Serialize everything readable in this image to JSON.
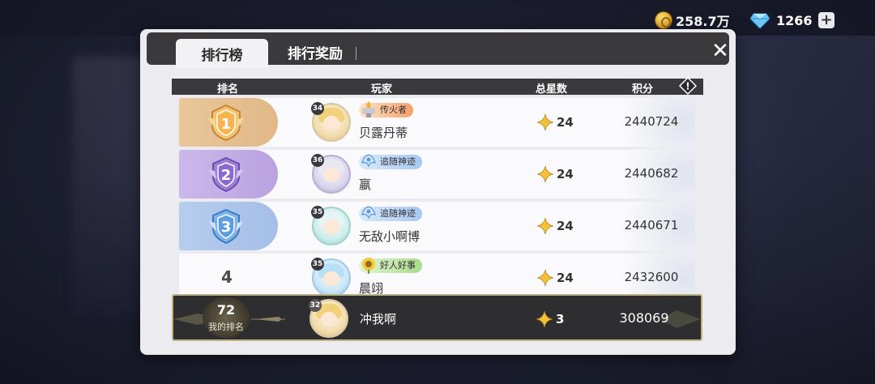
{
  "currency": {
    "coins": "258.7万",
    "gems": "1266",
    "add_label": "+"
  },
  "tabs": [
    {
      "label": "排行榜",
      "active": true
    },
    {
      "label": "排行奖励",
      "active": false
    }
  ],
  "close_label": "✕",
  "columns": {
    "rank": "排名",
    "player": "玩家",
    "stars": "总星数",
    "points": "积分",
    "info": "!"
  },
  "rows": [
    {
      "rank": "1",
      "level": "34",
      "title": "传火者",
      "name": "贝露丹蒂",
      "stars": "24",
      "points": "2440724"
    },
    {
      "rank": "2",
      "level": "36",
      "title": "追随神迹",
      "name": "嬴",
      "stars": "24",
      "points": "2440682"
    },
    {
      "rank": "3",
      "level": "35",
      "title": "追随神迹",
      "name": "无敌小啊博",
      "stars": "24",
      "points": "2440671"
    },
    {
      "rank": "4",
      "level": "35",
      "title": "好人好事",
      "name": "晨翊",
      "stars": "24",
      "points": "2432600"
    }
  ],
  "my_row": {
    "rank": "72",
    "rank_label": "我的排名",
    "level": "32",
    "name": "冲我啊",
    "stars": "3",
    "points": "308069"
  },
  "colors": {
    "gold": "#e0b886",
    "purple": "#b9a2e0",
    "blue": "#a4bfe6",
    "dark": "#2e2e30",
    "accent_border": "#c2b07e"
  }
}
